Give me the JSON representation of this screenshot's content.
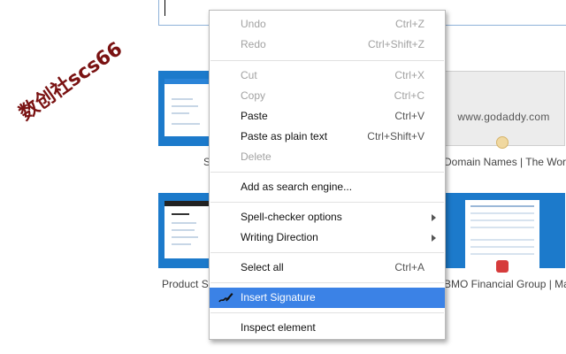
{
  "watermark": "数创社scs66",
  "tiles": {
    "godaddy_text": "www.godaddy.com",
    "label_top_left": "S",
    "label_top_right": "Domain Names | The World...",
    "label_bottom_left": "Product Su",
    "label_bottom_right": "BMO Financial Group | Mak..."
  },
  "menu": {
    "items": [
      {
        "label": "Undo",
        "shortcut": "Ctrl+Z"
      },
      {
        "label": "Redo",
        "shortcut": "Ctrl+Shift+Z"
      },
      {
        "label": "Cut",
        "shortcut": "Ctrl+X"
      },
      {
        "label": "Copy",
        "shortcut": "Ctrl+C"
      },
      {
        "label": "Paste",
        "shortcut": "Ctrl+V"
      },
      {
        "label": "Paste as plain text",
        "shortcut": "Ctrl+Shift+V"
      },
      {
        "label": "Delete",
        "shortcut": ""
      },
      {
        "label": "Add as search engine...",
        "shortcut": ""
      },
      {
        "label": "Spell-checker options",
        "shortcut": ""
      },
      {
        "label": "Writing Direction",
        "shortcut": ""
      },
      {
        "label": "Select all",
        "shortcut": "Ctrl+A"
      },
      {
        "label": "Insert Signature",
        "shortcut": ""
      },
      {
        "label": "Inspect element",
        "shortcut": ""
      }
    ]
  },
  "colors": {
    "highlight": "#3b82e6",
    "disabled_text": "#a2a2a2",
    "watermark": "#7a1212",
    "tile_blue": "#1c7acb"
  },
  "icons": {
    "insert_signature": "signature-pen-icon",
    "submenu": "chevron-right-icon"
  }
}
